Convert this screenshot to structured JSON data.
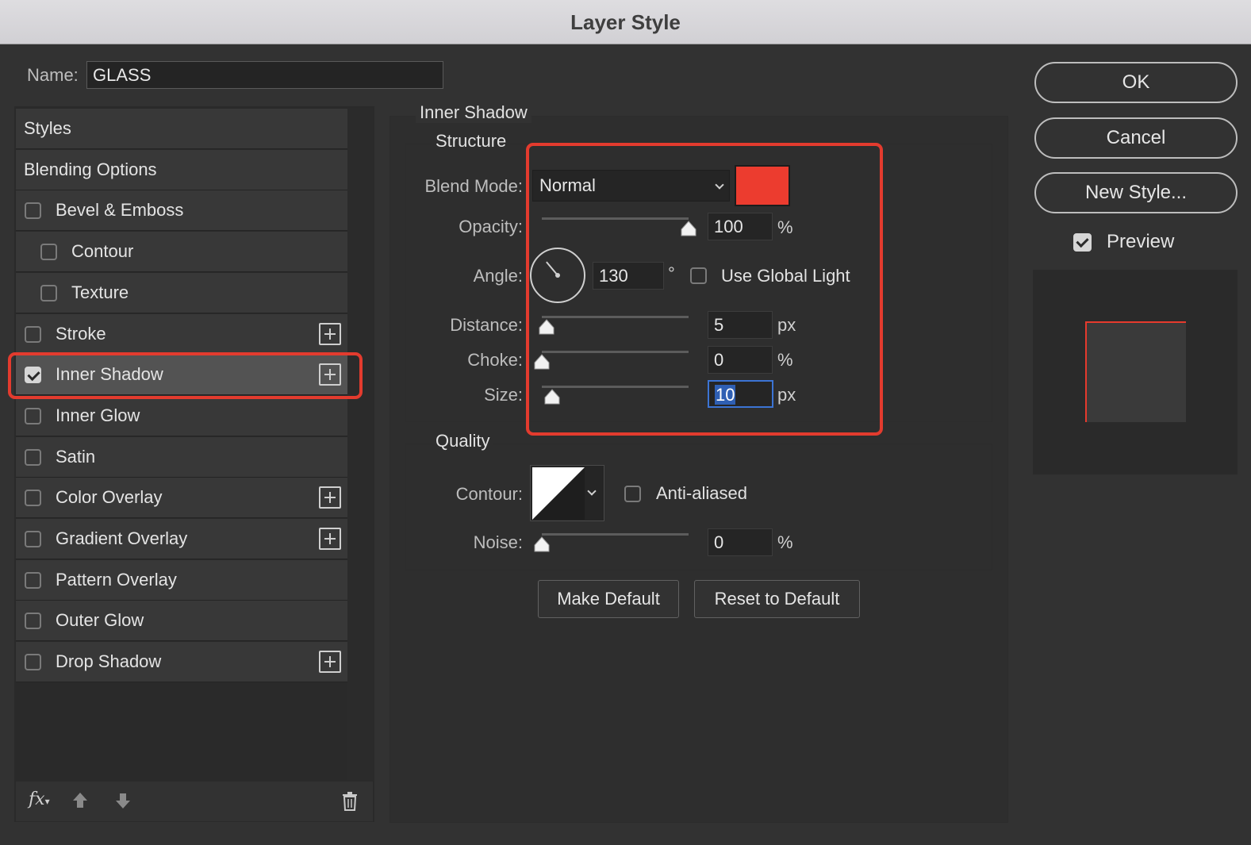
{
  "window": {
    "title": "Layer Style"
  },
  "name_field": {
    "label": "Name:",
    "value": "GLASS"
  },
  "styles_list": {
    "items": [
      {
        "label": "Styles",
        "checkbox": null,
        "plus": false,
        "checked": false
      },
      {
        "label": "Blending Options",
        "checkbox": null,
        "plus": false,
        "checked": false
      },
      {
        "label": "Bevel & Emboss",
        "checkbox": true,
        "plus": false,
        "checked": false
      },
      {
        "label": "Contour",
        "checkbox": true,
        "plus": false,
        "checked": false
      },
      {
        "label": "Texture",
        "checkbox": true,
        "plus": false,
        "checked": false
      },
      {
        "label": "Stroke",
        "checkbox": true,
        "plus": true,
        "checked": false
      },
      {
        "label": "Inner Shadow",
        "checkbox": true,
        "plus": true,
        "checked": true
      },
      {
        "label": "Inner Glow",
        "checkbox": true,
        "plus": false,
        "checked": false
      },
      {
        "label": "Satin",
        "checkbox": true,
        "plus": false,
        "checked": false
      },
      {
        "label": "Color Overlay",
        "checkbox": true,
        "plus": true,
        "checked": false
      },
      {
        "label": "Gradient Overlay",
        "checkbox": true,
        "plus": true,
        "checked": false
      },
      {
        "label": "Pattern Overlay",
        "checkbox": true,
        "plus": false,
        "checked": false
      },
      {
        "label": "Outer Glow",
        "checkbox": true,
        "plus": false,
        "checked": false
      },
      {
        "label": "Drop Shadow",
        "checkbox": true,
        "plus": true,
        "checked": false
      }
    ],
    "selected": "Inner Shadow",
    "footer": {
      "fx_label": "fx",
      "icons": [
        "fx-icon",
        "move-up-icon",
        "move-down-icon",
        "trash-icon"
      ]
    }
  },
  "inner_shadow": {
    "panel_title": "Inner Shadow",
    "structure": {
      "title": "Structure",
      "blend_mode": {
        "label": "Blend Mode:",
        "value": "Normal"
      },
      "shadow_color": "#ec3c2f",
      "opacity": {
        "label": "Opacity:",
        "value": "100",
        "unit": "%",
        "level": 1.0
      },
      "angle": {
        "label": "Angle:",
        "value": "130",
        "unit": "°",
        "degrees": 130
      },
      "use_global_light": {
        "label": "Use Global Light",
        "checked": false
      },
      "distance": {
        "label": "Distance:",
        "value": "5",
        "unit": "px",
        "level": 0.03
      },
      "choke": {
        "label": "Choke:",
        "value": "0",
        "unit": "%",
        "level": 0.0
      },
      "size": {
        "label": "Size:",
        "value": "10",
        "unit": "px",
        "level": 0.07
      }
    },
    "quality": {
      "title": "Quality",
      "contour": {
        "label": "Contour:"
      },
      "anti_aliased": {
        "label": "Anti-aliased",
        "checked": false
      },
      "noise": {
        "label": "Noise:",
        "value": "0",
        "unit": "%",
        "level": 0.0
      }
    },
    "make_default": "Make Default",
    "reset_default": "Reset to Default"
  },
  "actions": {
    "ok": "OK",
    "cancel": "Cancel",
    "new_style": "New Style...",
    "preview": {
      "label": "Preview",
      "checked": true
    }
  },
  "colors": {
    "highlight": "#e33b2e",
    "accent_focus": "#3c74d4"
  }
}
